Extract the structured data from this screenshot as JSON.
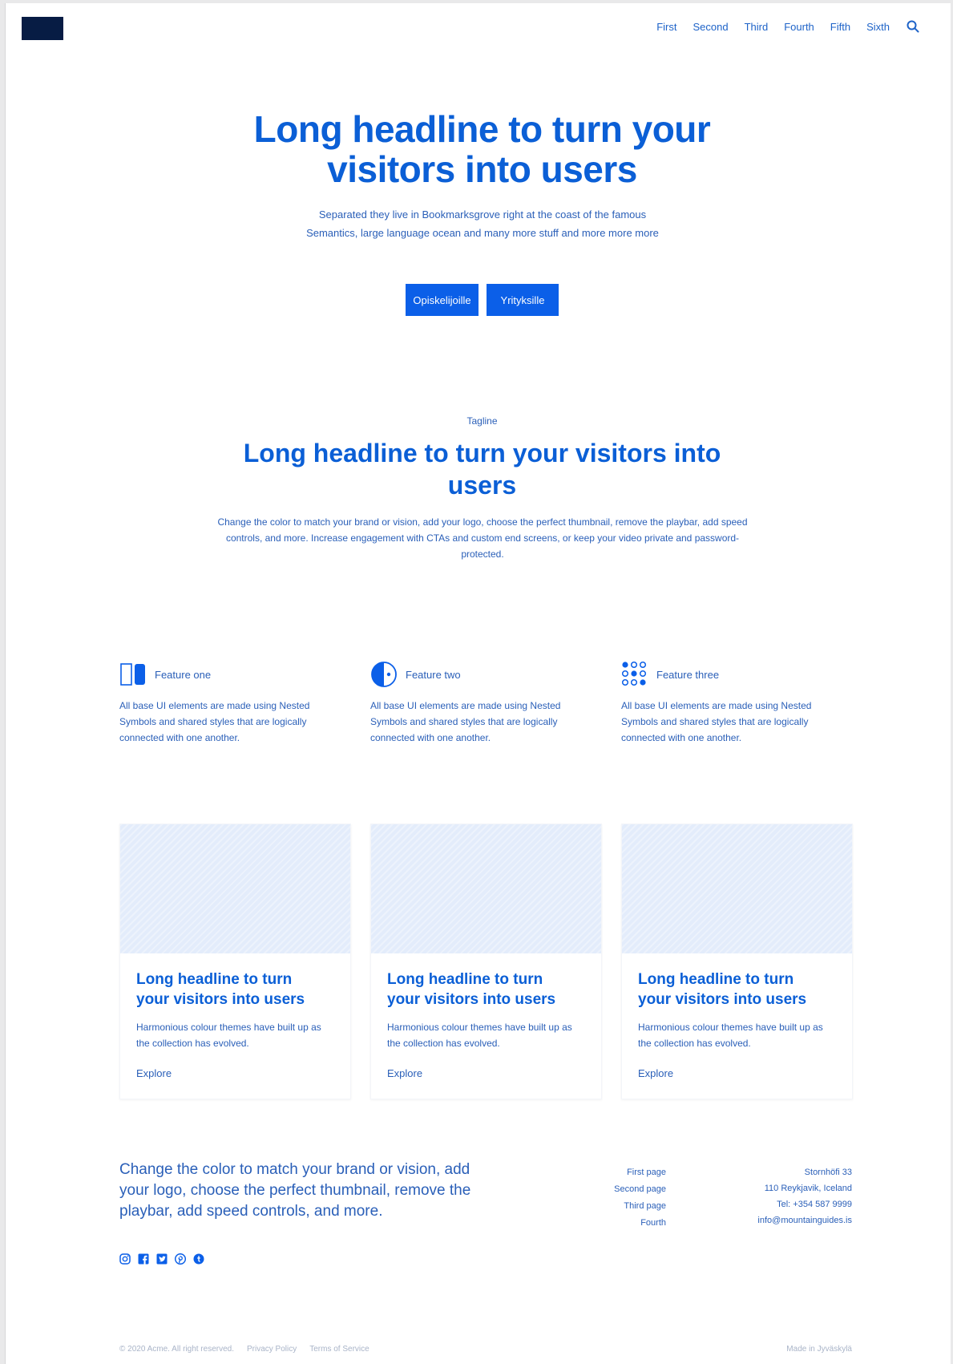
{
  "header": {
    "nav": [
      "First",
      "Second",
      "Third",
      "Fourth",
      "Fifth",
      "Sixth"
    ]
  },
  "hero": {
    "title_line1": "Long headline to turn your",
    "title_line2": "visitors into users",
    "subtitle": "Separated they live in Bookmarksgrove right at the coast of the famous Semantics, large language ocean and many more stuff and more more more",
    "button1": "Opiskelijoille",
    "button2": "Yrityksille"
  },
  "section": {
    "tagline": "Tagline",
    "title_line1": "Long headline to turn your visitors into",
    "title_line2": "users",
    "text": "Change the color to match your brand or vision, add your logo, choose the perfect thumbnail, remove the playbar, add speed controls, and more. Increase engagement with CTAs and custom end screens, or keep your video private and password-protected."
  },
  "features": [
    {
      "title": "Feature one",
      "icon": "split-rectangle-icon",
      "text": "All base UI elements are made using Nested Symbols and shared styles that are logically connected with one another."
    },
    {
      "title": "Feature two",
      "icon": "half-circle-icon",
      "text": "All base UI elements are made using Nested Symbols and shared styles that are logically connected with one another."
    },
    {
      "title": "Feature three",
      "icon": "dots-grid-icon",
      "text": "All base UI elements are made using Nested Symbols and shared styles that are logically connected with one another."
    }
  ],
  "cards": [
    {
      "title_line1": "Long headline to turn",
      "title_line2": "your visitors into users",
      "text": "Harmonious colour themes have built up as the collection has evolved.",
      "link": "Explore"
    },
    {
      "title_line1": "Long headline to turn",
      "title_line2": "your visitors into users",
      "text": "Harmonious colour themes have built up as the collection has evolved.",
      "link": "Explore"
    },
    {
      "title_line1": "Long headline to turn",
      "title_line2": "your visitors into users",
      "text": "Harmonious colour themes have built up as the collection has evolved.",
      "link": "Explore"
    }
  ],
  "footer": {
    "lead": "Change the color to match your brand or vision, add your logo, choose the perfect thumbnail, remove the playbar, add speed controls, and more.",
    "links": [
      "First page",
      "Second page",
      "Third page",
      "Fourth"
    ],
    "address": [
      "Stornhöfi 33",
      "110 Reykjavik, Iceland",
      "Tel: +354 587 9999",
      "info@mountainguides.is"
    ],
    "social_icons": [
      "instagram-icon",
      "facebook-icon",
      "twitter-icon",
      "pinterest-icon",
      "tumblr-icon"
    ],
    "copyright": "© 2020 Acme. All right reserved.",
    "privacy": "Privacy Policy",
    "terms": "Terms of Service",
    "made": "Made in Jyväskylä"
  },
  "colors": {
    "primary": "#0b5fd6",
    "button": "#0b5fe8",
    "logo": "#071c44",
    "card_image": "#e3ecfb"
  }
}
